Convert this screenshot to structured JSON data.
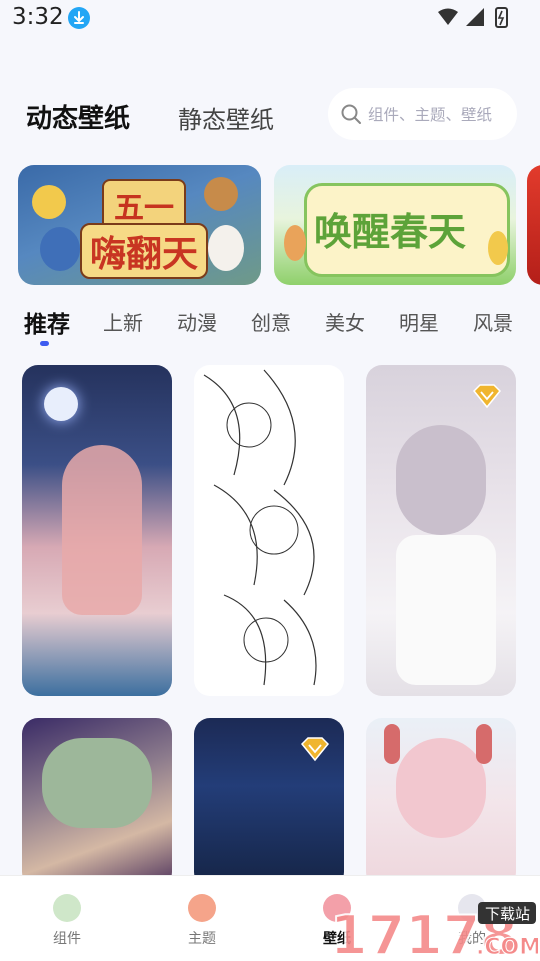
{
  "status_bar": {
    "time": "3:32"
  },
  "top_tabs": {
    "active": "动态壁纸",
    "inactive": "静态壁纸"
  },
  "search": {
    "placeholder": "组件、主题、壁纸"
  },
  "banners": [
    {
      "line1": "五一",
      "line2": "嗨翻天"
    },
    {
      "text": "唤醒春天"
    }
  ],
  "categories": [
    "推荐",
    "上新",
    "动漫",
    "创意",
    "美女",
    "明星",
    "风景"
  ],
  "bottom_nav": [
    {
      "label": "组件"
    },
    {
      "label": "主题"
    },
    {
      "label": "壁纸"
    },
    {
      "label": "我的"
    }
  ],
  "watermark": {
    "brand": "17178",
    "tag": "下载站",
    "suffix": ".COM"
  },
  "colors": {
    "accent": "#3e5cf0",
    "vip_gold": "#f0b52e",
    "background": "#f6f7fc"
  }
}
